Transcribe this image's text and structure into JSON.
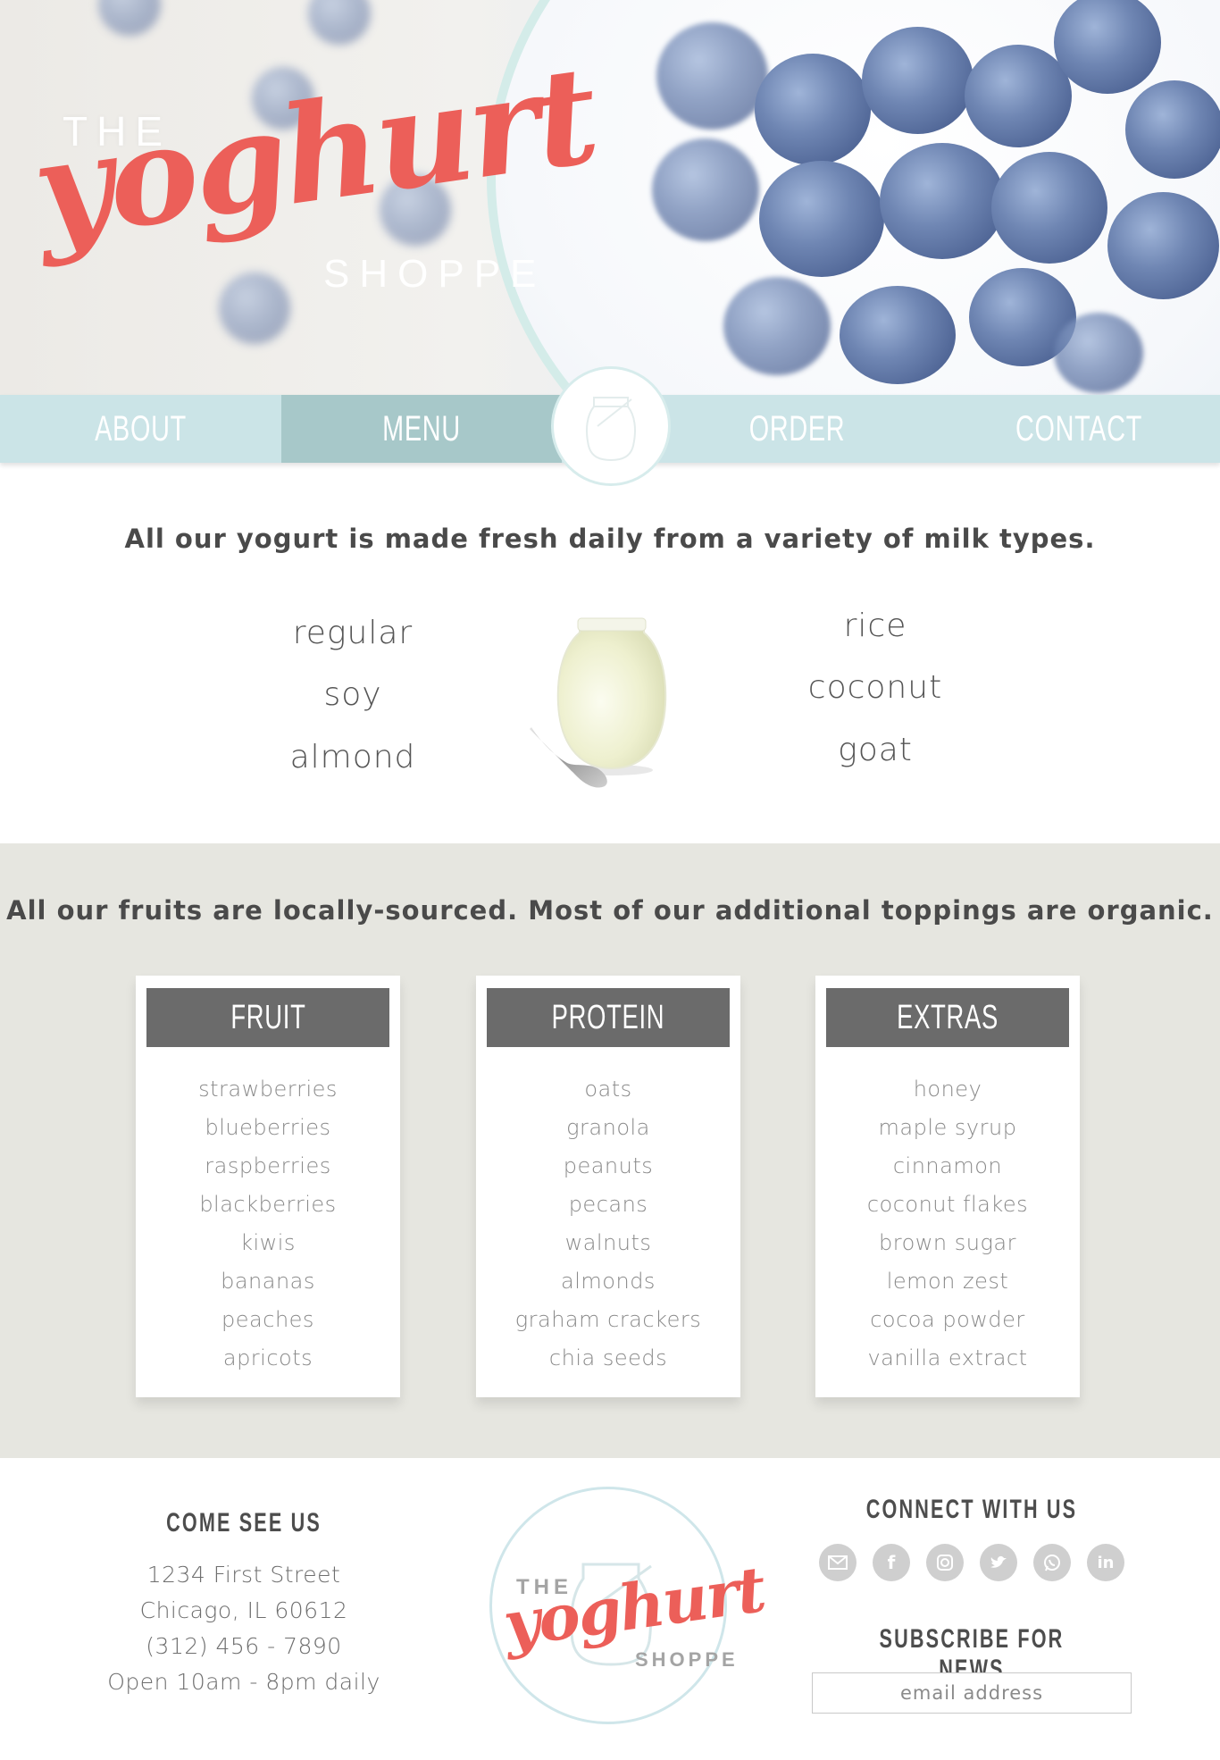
{
  "brand": {
    "the": "THE",
    "name": "yoghurt",
    "shoppe": "SHOPPE",
    "accent": "#ec5f59"
  },
  "nav": {
    "items": [
      "ABOUT",
      "MENU",
      "ORDER",
      "CONTACT"
    ],
    "active": "MENU",
    "emblem_icon": "yogurt-jar-icon"
  },
  "milk": {
    "heading": "All our yogurt is made fresh daily from a variety of milk types.",
    "left": [
      "regular",
      "soy",
      "almond"
    ],
    "right": [
      "rice",
      "coconut",
      "goat"
    ]
  },
  "toppings": {
    "heading": "All our fruits are locally-sourced. Most of our additional toppings are organic.",
    "cards": [
      {
        "title": "FRUIT",
        "items": [
          "strawberries",
          "blueberries",
          "raspberries",
          "blackberries",
          "kiwis",
          "bananas",
          "peaches",
          "apricots"
        ]
      },
      {
        "title": "PROTEIN",
        "items": [
          "oats",
          "granola",
          "peanuts",
          "pecans",
          "walnuts",
          "almonds",
          "graham crackers",
          "chia seeds"
        ]
      },
      {
        "title": "EXTRAS",
        "items": [
          "honey",
          "maple syrup",
          "cinnamon",
          "coconut flakes",
          "brown sugar",
          "lemon zest",
          "cocoa powder",
          "vanilla extract"
        ]
      }
    ]
  },
  "footer": {
    "visit_title": "COME SEE US",
    "address": [
      "1234 First Street",
      "Chicago, IL 60612",
      "(312) 456 - 7890",
      "Open 10am - 8pm daily"
    ],
    "connect_title": "CONNECT WITH US",
    "social_icons": [
      "email-icon",
      "facebook-icon",
      "instagram-icon",
      "twitter-icon",
      "whatsapp-icon",
      "linkedin-icon"
    ],
    "subscribe_title": "SUBSCRIBE FOR NEWS",
    "email_placeholder": "email address"
  }
}
